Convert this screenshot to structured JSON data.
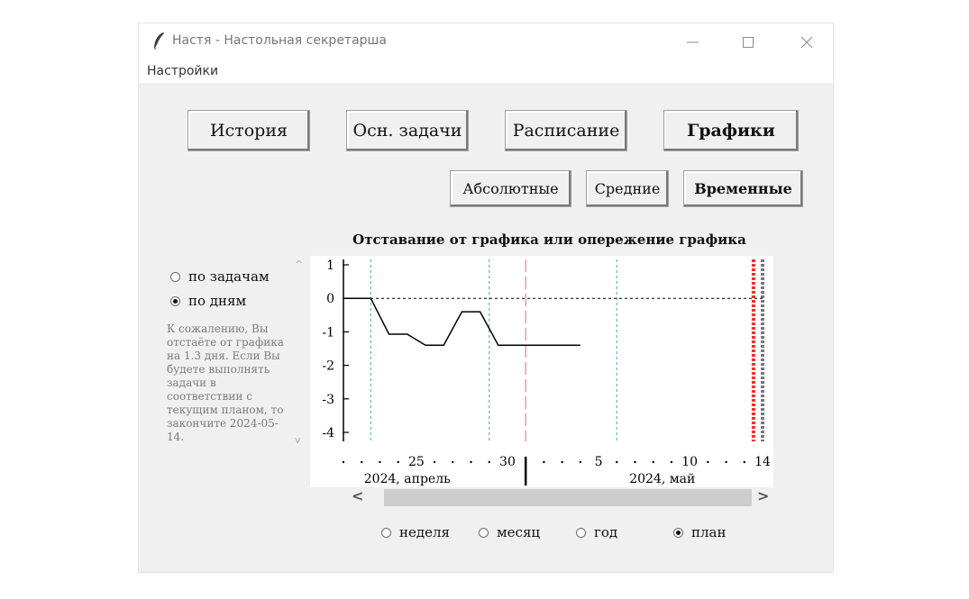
{
  "window": {
    "title": "Настя - Настольная секретарша",
    "menu": [
      "Настройки"
    ]
  },
  "top_buttons": [
    {
      "label": "История",
      "active": false
    },
    {
      "label": "Осн. задачи",
      "active": false
    },
    {
      "label": "Расписание",
      "active": false
    },
    {
      "label": "Графики",
      "active": true
    }
  ],
  "sub_buttons": [
    {
      "label": "Абсолютные",
      "active": false
    },
    {
      "label": "Средние",
      "active": false
    },
    {
      "label": "Временные",
      "active": true
    }
  ],
  "mode_radio": {
    "options": [
      "по задачам",
      "по дням"
    ],
    "selected": "по дням"
  },
  "info_text": "К сожалению, Вы отстаёте от графика на 1.3 дня. Если Вы будете выполнять задачи в соответствии с текущим планом, то закончите 2024-05-14.",
  "range_radio": {
    "options": [
      "неделя",
      "месяц",
      "год",
      "план"
    ],
    "selected": "план"
  },
  "chart_data": {
    "type": "line",
    "title": "Отставание от графика или опережение графика",
    "y_ticks": [
      "1",
      "0",
      "-1",
      "-2",
      "-3",
      "-4"
    ],
    "ylim": [
      -4,
      1
    ],
    "x_tick_labels": [
      {
        "label": "25",
        "day": 25
      },
      {
        "label": "30",
        "day": 30
      },
      {
        "label": "5",
        "day": 35
      },
      {
        "label": "10",
        "day": 40
      },
      {
        "label": "14",
        "day": 44
      }
    ],
    "month_labels": [
      {
        "label": "2024, апрель",
        "day": 24.5
      },
      {
        "label": "2024, май",
        "day": 38.5
      }
    ],
    "xlim": [
      21,
      44
    ],
    "series": [
      {
        "color": "#000000",
        "points": [
          [
            21,
            0
          ],
          [
            22.5,
            0
          ],
          [
            23.5,
            -1.07
          ],
          [
            24.5,
            -1.07
          ],
          [
            25.5,
            -1.4
          ],
          [
            26.5,
            -1.4
          ],
          [
            27.5,
            -0.4
          ],
          [
            28.5,
            -0.4
          ],
          [
            29.5,
            -1.4
          ],
          [
            34,
            -1.4
          ]
        ]
      }
    ],
    "zero_line": {
      "y": 0,
      "style": "dotted"
    },
    "vlines": [
      {
        "day": 22.5,
        "color": "#5fb3c6",
        "style": "dotted"
      },
      {
        "day": 29,
        "color": "#5fb3c6",
        "style": "dotted"
      },
      {
        "day": 31,
        "color": "#e08ea2",
        "style": "dashed"
      },
      {
        "day": 36,
        "color": "#5fb3c6",
        "style": "dotted"
      },
      {
        "day": 43.5,
        "color": "#ff2a2a",
        "style": "heavy-dotted"
      },
      {
        "day": 44,
        "color": "#777777",
        "style": "heavy-dotted"
      }
    ],
    "today_marker_day": 31,
    "grid": false
  }
}
